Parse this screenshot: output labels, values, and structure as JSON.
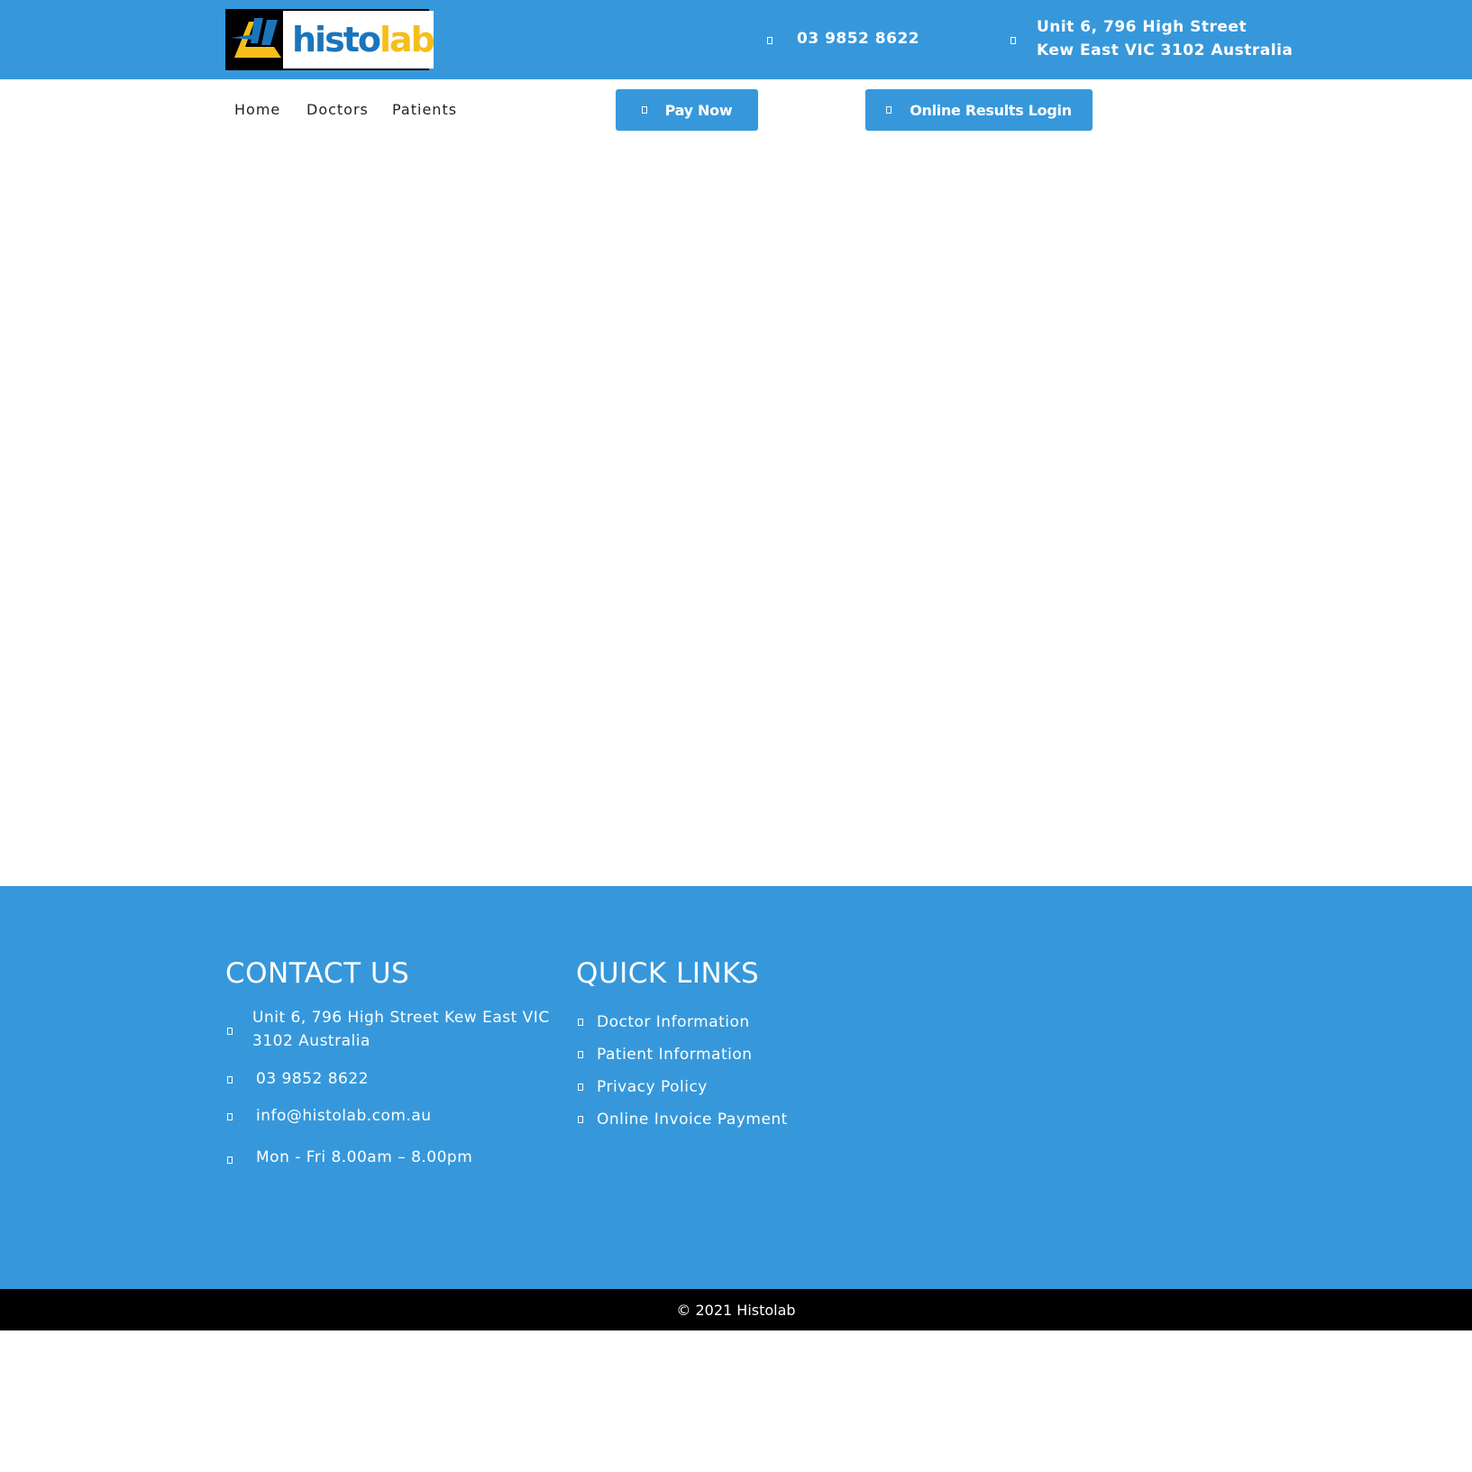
{
  "header": {
    "logo": {
      "text_a": "histo",
      "text_b": "lab"
    },
    "phone": "03 9852 8622",
    "address_line1": "Unit 6, 796 High Street",
    "address_line2": "Kew East VIC 3102 Australia"
  },
  "nav": {
    "items": [
      {
        "label": "Home"
      },
      {
        "label": "Doctors"
      },
      {
        "label": "Patients"
      }
    ],
    "pay_now": "Pay Now",
    "results_login": "Online Results Login"
  },
  "footer": {
    "contact_title": "CONTACT US",
    "contact": {
      "address": "Unit 6, 796 High Street Kew East VIC 3102 Australia",
      "phone": "03 9852 8622",
      "email": "info@histolab.com.au",
      "hours": "Mon - Fri 8.00am – 8.00pm"
    },
    "links_title": "QUICK LINKS",
    "links": [
      {
        "label": "Doctor Information"
      },
      {
        "label": "Patient Information"
      },
      {
        "label": "Privacy Policy"
      },
      {
        "label": "Online Invoice Payment"
      }
    ],
    "copyright": "© 2021 Histolab"
  },
  "colors": {
    "brand_blue": "#3698db",
    "logo_blue": "#1a75bb",
    "logo_yellow": "#f6be1a"
  }
}
